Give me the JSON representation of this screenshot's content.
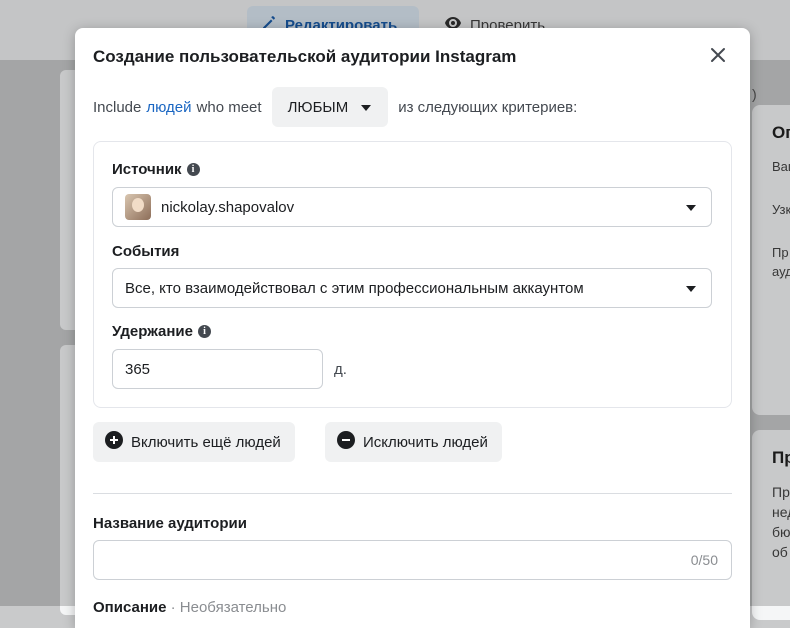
{
  "background": {
    "tab_edit": "Редактировать",
    "tab_check": "Проверить",
    "right_card_title": "Оп",
    "right_card_lines": [
      "Ваш",
      "Узк",
      "Пр",
      "ауд"
    ],
    "right_card2_title": "Пр",
    "right_card2_lines": [
      "Пр",
      "нед",
      "бю",
      "об"
    ],
    "bracket": ")"
  },
  "modal": {
    "title": "Создание пользовательской аудитории Instagram",
    "criteria": {
      "prefix": "Include",
      "link": "людей",
      "middle": "who meet",
      "any_value": "ЛЮБЫМ",
      "suffix": "из следующих критериев:"
    },
    "source": {
      "label": "Источник",
      "value": "nickolay.shapovalov"
    },
    "events": {
      "label": "События",
      "value": "Все, кто взаимодействовал с этим профессиональным аккаунтом"
    },
    "retention": {
      "label": "Удержание",
      "value": "365",
      "unit": "д."
    },
    "include_button": "Включить ещё людей",
    "exclude_button": "Исключить людей",
    "audience_name": {
      "label": "Название аудитории",
      "value": "",
      "counter": "0/50"
    },
    "description": {
      "label": "Описание",
      "optional": "· Необязательно"
    }
  },
  "colors": {
    "link": "#1a66c2",
    "edit_tab": "#1a5dab"
  }
}
